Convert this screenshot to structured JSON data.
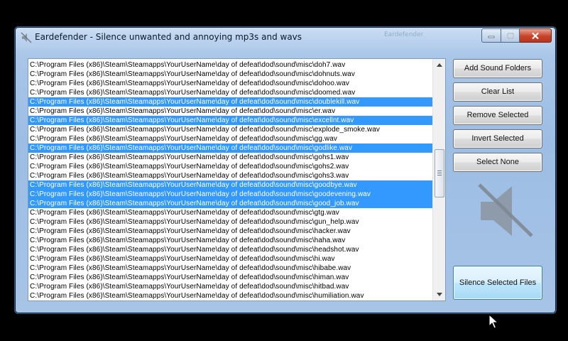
{
  "window": {
    "title": "Eardefender  - Silence unwanted and annoying mp3s and wavs",
    "ghost_text": "Eardefender",
    "controls": {
      "minimize": "minimize",
      "maximize": "maximize",
      "close": "close"
    }
  },
  "file_list": {
    "rows": [
      {
        "path": "C:\\Program Files (x86)\\Steam\\Steamapps\\YourUserName\\day of defeat\\dod\\sound\\misc\\doh7.wav",
        "selected": false
      },
      {
        "path": "C:\\Program Files (x86)\\Steam\\Steamapps\\YourUserName\\day of defeat\\dod\\sound\\misc\\dohnuts.wav",
        "selected": false
      },
      {
        "path": "C:\\Program Files (x86)\\Steam\\Steamapps\\YourUserName\\day of defeat\\dod\\sound\\misc\\dohoo.wav",
        "selected": false
      },
      {
        "path": "C:\\Program Files (x86)\\Steam\\Steamapps\\YourUserName\\day of defeat\\dod\\sound\\misc\\doomed.wav",
        "selected": false
      },
      {
        "path": "C:\\Program Files (x86)\\Steam\\Steamapps\\YourUserName\\day of defeat\\dod\\sound\\misc\\doublekill.wav",
        "selected": true
      },
      {
        "path": "C:\\Program Files (x86)\\Steam\\Steamapps\\YourUserName\\day of defeat\\dod\\sound\\misc\\er.wav",
        "selected": false
      },
      {
        "path": "C:\\Program Files (x86)\\Steam\\Steamapps\\YourUserName\\day of defeat\\dod\\sound\\misc\\excellnt.wav",
        "selected": true
      },
      {
        "path": "C:\\Program Files (x86)\\Steam\\Steamapps\\YourUserName\\day of defeat\\dod\\sound\\misc\\explode_smoke.wav",
        "selected": false
      },
      {
        "path": "C:\\Program Files (x86)\\Steam\\Steamapps\\YourUserName\\day of defeat\\dod\\sound\\misc\\gg.wav",
        "selected": false
      },
      {
        "path": "C:\\Program Files (x86)\\Steam\\Steamapps\\YourUserName\\day of defeat\\dod\\sound\\misc\\godlike.wav",
        "selected": true
      },
      {
        "path": "C:\\Program Files (x86)\\Steam\\Steamapps\\YourUserName\\day of defeat\\dod\\sound\\misc\\gohs1.wav",
        "selected": false
      },
      {
        "path": "C:\\Program Files (x86)\\Steam\\Steamapps\\YourUserName\\day of defeat\\dod\\sound\\misc\\gohs2.wav",
        "selected": false
      },
      {
        "path": "C:\\Program Files (x86)\\Steam\\Steamapps\\YourUserName\\day of defeat\\dod\\sound\\misc\\gohs3.wav",
        "selected": false
      },
      {
        "path": "C:\\Program Files (x86)\\Steam\\Steamapps\\YourUserName\\day of defeat\\dod\\sound\\misc\\goodbye.wav",
        "selected": true
      },
      {
        "path": "C:\\Program Files (x86)\\Steam\\Steamapps\\YourUserName\\day of defeat\\dod\\sound\\misc\\goodevening.wav",
        "selected": true
      },
      {
        "path": "C:\\Program Files (x86)\\Steam\\Steamapps\\YourUserName\\day of defeat\\dod\\sound\\misc\\good_job.wav",
        "selected": true
      },
      {
        "path": "C:\\Program Files (x86)\\Steam\\Steamapps\\YourUserName\\day of defeat\\dod\\sound\\misc\\gtg.wav",
        "selected": false
      },
      {
        "path": "C:\\Program Files (x86)\\Steam\\Steamapps\\YourUserName\\day of defeat\\dod\\sound\\misc\\gun_help.wav",
        "selected": false
      },
      {
        "path": "C:\\Program Files (x86)\\Steam\\Steamapps\\YourUserName\\day of defeat\\dod\\sound\\misc\\hacker.wav",
        "selected": false
      },
      {
        "path": "C:\\Program Files (x86)\\Steam\\Steamapps\\YourUserName\\day of defeat\\dod\\sound\\misc\\haha.wav",
        "selected": false
      },
      {
        "path": "C:\\Program Files (x86)\\Steam\\Steamapps\\YourUserName\\day of defeat\\dod\\sound\\misc\\headshot.wav",
        "selected": false
      },
      {
        "path": "C:\\Program Files (x86)\\Steam\\Steamapps\\YourUserName\\day of defeat\\dod\\sound\\misc\\hi.wav",
        "selected": false
      },
      {
        "path": "C:\\Program Files (x86)\\Steam\\Steamapps\\YourUserName\\day of defeat\\dod\\sound\\misc\\hibabe.wav",
        "selected": false
      },
      {
        "path": "C:\\Program Files (x86)\\Steam\\Steamapps\\YourUserName\\day of defeat\\dod\\sound\\misc\\himan.wav",
        "selected": false
      },
      {
        "path": "C:\\Program Files (x86)\\Steam\\Steamapps\\YourUserName\\day of defeat\\dod\\sound\\misc\\hitbad.wav",
        "selected": false
      },
      {
        "path": "C:\\Program Files (x86)\\Steam\\Steamapps\\YourUserName\\day of defeat\\dod\\sound\\misc\\humiliation.wav",
        "selected": false
      }
    ]
  },
  "buttons": {
    "add_sound_folders": "Add Sound Folders",
    "clear_list": "Clear List",
    "remove_selected": "Remove Selected",
    "invert_selected": "Invert Selected",
    "select_none": "Select  None",
    "silence_selected_files": "Silence Selected Files"
  },
  "icons": {
    "app": "speaker-icon",
    "mute": "muted-speaker-icon",
    "cursor": "mouse-pointer-icon"
  },
  "colors": {
    "selection": "#3399ff",
    "window_frame": "#a9c6e8",
    "close_button": "#c7442b",
    "silence_button": "#bee6fd"
  }
}
